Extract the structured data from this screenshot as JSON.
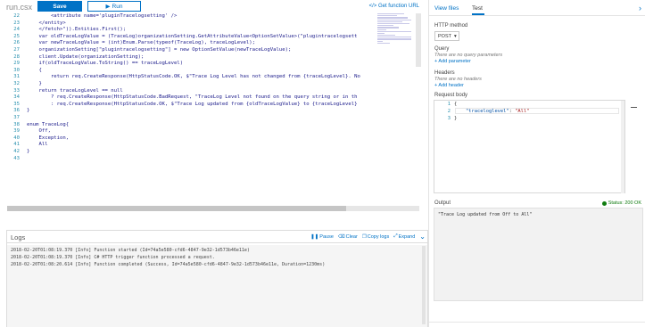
{
  "toolbar": {
    "file_name": "run.csx",
    "save_label": "Save",
    "run_label": "Run",
    "run_icon": "▶",
    "get_url_label": "</> Get function URL"
  },
  "editor": {
    "lines": [
      {
        "num": "22",
        "code": "        <attribute name='pluginTracelogsetting' />"
      },
      {
        "num": "23",
        "code": "    </entity>"
      },
      {
        "num": "24",
        "code": "    </fetch>\")).Entities.First();"
      },
      {
        "num": "25",
        "code": "    var oldTraceLogValue = (TraceLog)organizationSetting.GetAttributeValue<OptionSetValue>(\"plugintracelogsett"
      },
      {
        "num": "26",
        "code": "    var newTraceLogValue = (int)Enum.Parse(typeof(TraceLog), traceLogLevel);"
      },
      {
        "num": "27",
        "code": "    organizationSetting[\"plugintracelogsetting\"] = new OptionSetValue(newTraceLogValue);"
      },
      {
        "num": "28",
        "code": "    client.Update(organizationSetting);"
      },
      {
        "num": "29",
        "code": "    if(oldTraceLogValue.ToString() == traceLogLevel)"
      },
      {
        "num": "30",
        "code": "    {"
      },
      {
        "num": "31",
        "code": "        return req.CreateResponse(HttpStatusCode.OK, $\"Trace Log Level has not changed from {traceLogLevel}. No"
      },
      {
        "num": "32",
        "code": "    }"
      },
      {
        "num": "33",
        "code": "    return traceLogLevel == null"
      },
      {
        "num": "34",
        "code": "        ? req.CreateResponse(HttpStatusCode.BadRequest, \"TraceLog Level not found on the query string or in th"
      },
      {
        "num": "35",
        "code": "        : req.CreateResponse(HttpStatusCode.OK, $\"Trace Log updated from {oldTraceLogValue} to {traceLogLevel}"
      },
      {
        "num": "36",
        "code": "}"
      },
      {
        "num": "37",
        "code": ""
      },
      {
        "num": "38",
        "code": "enum TraceLog{"
      },
      {
        "num": "39",
        "code": "    Off,"
      },
      {
        "num": "40",
        "code": "    Exception,"
      },
      {
        "num": "41",
        "code": "    All"
      },
      {
        "num": "42",
        "code": "}"
      },
      {
        "num": "43",
        "code": ""
      }
    ]
  },
  "logs": {
    "title": "Logs",
    "pause_label": "Pause",
    "clear_label": "Clear",
    "copy_label": "Copy logs",
    "expand_label": "Expand",
    "lines": [
      "2018-02-20T01:08:19.370 [Info] Function started (Id=74a5e580-cfd6-4847-9e32-1d573b46e11e)",
      "2018-02-20T01:08:19.370 [Info] C# HTTP trigger function processed a request.",
      "2018-02-20T01:08:20.614 [Info] Function completed (Success, Id=74a5e580-cfd6-4847-9e32-1d573b46e11e, Duration=1230ms)"
    ]
  },
  "right": {
    "tab_view_files": "View files",
    "tab_test": "Test",
    "http_method_label": "HTTP method",
    "http_method_value": "POST",
    "query_label": "Query",
    "query_empty": "There are no query parameters",
    "add_parameter": "+ Add parameter",
    "headers_label": "Headers",
    "headers_empty": "There are no headers",
    "add_header": "+ Add header",
    "request_body_label": "Request body",
    "body_lines": [
      {
        "num": "1",
        "text": "{"
      },
      {
        "num": "2",
        "key": "\"traceloglevel\"",
        "sep": ": ",
        "val": "\"All\""
      },
      {
        "num": "3",
        "text": "}"
      }
    ],
    "output_label": "Output",
    "status_text": "Status: 200 OK",
    "output_value": "\"Trace Log updated from Off to All\""
  },
  "colors": {
    "accent": "#0072c6",
    "success": "#107c10"
  }
}
